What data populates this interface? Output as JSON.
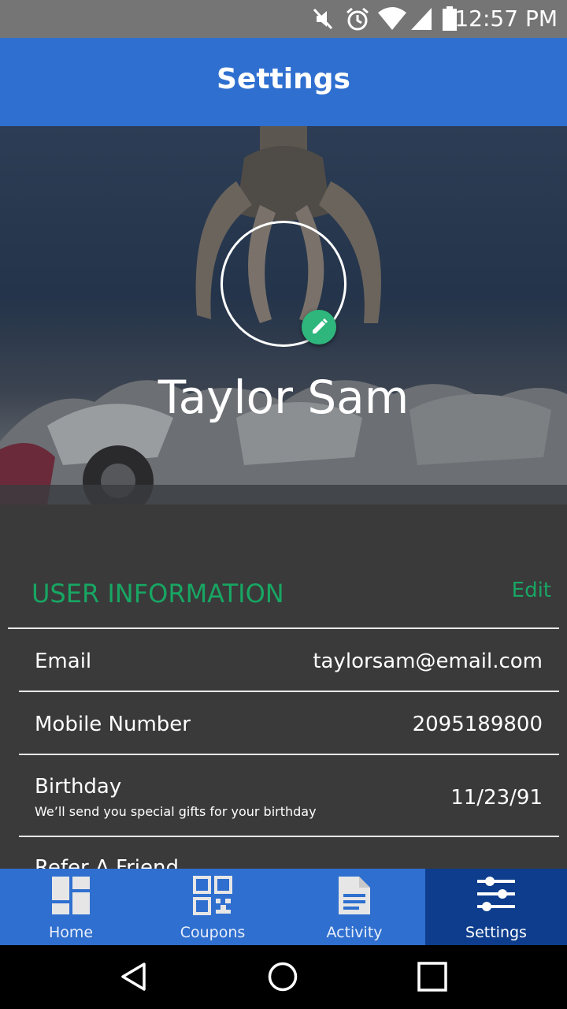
{
  "status_bar": {
    "time": "12:57 PM"
  },
  "app_bar": {
    "title": "Settings"
  },
  "profile": {
    "name": "Taylor Sam"
  },
  "user_info": {
    "section_title": "USER INFORMATION",
    "edit_label": "Edit",
    "email_label": "Email",
    "email_value": "taylorsam@email.com",
    "mobile_label": "Mobile Number",
    "mobile_value": "2095189800",
    "birthday_label": "Birthday",
    "birthday_sub": "We’ll send you special gifts for your birthday",
    "birthday_value": "11/23/91",
    "refer_label": "Refer A Friend"
  },
  "bottom_nav": {
    "items": [
      {
        "label": "Home",
        "icon": "dashboard-icon"
      },
      {
        "label": "Coupons",
        "icon": "qr-code-icon"
      },
      {
        "label": "Activity",
        "icon": "document-icon"
      },
      {
        "label": "Settings",
        "icon": "sliders-icon",
        "active": true
      }
    ]
  },
  "colors": {
    "primary": "#2f6fcf",
    "primary_dark": "#0d3d8c",
    "accent_green": "#18a663",
    "background": "#3a3a3a"
  }
}
